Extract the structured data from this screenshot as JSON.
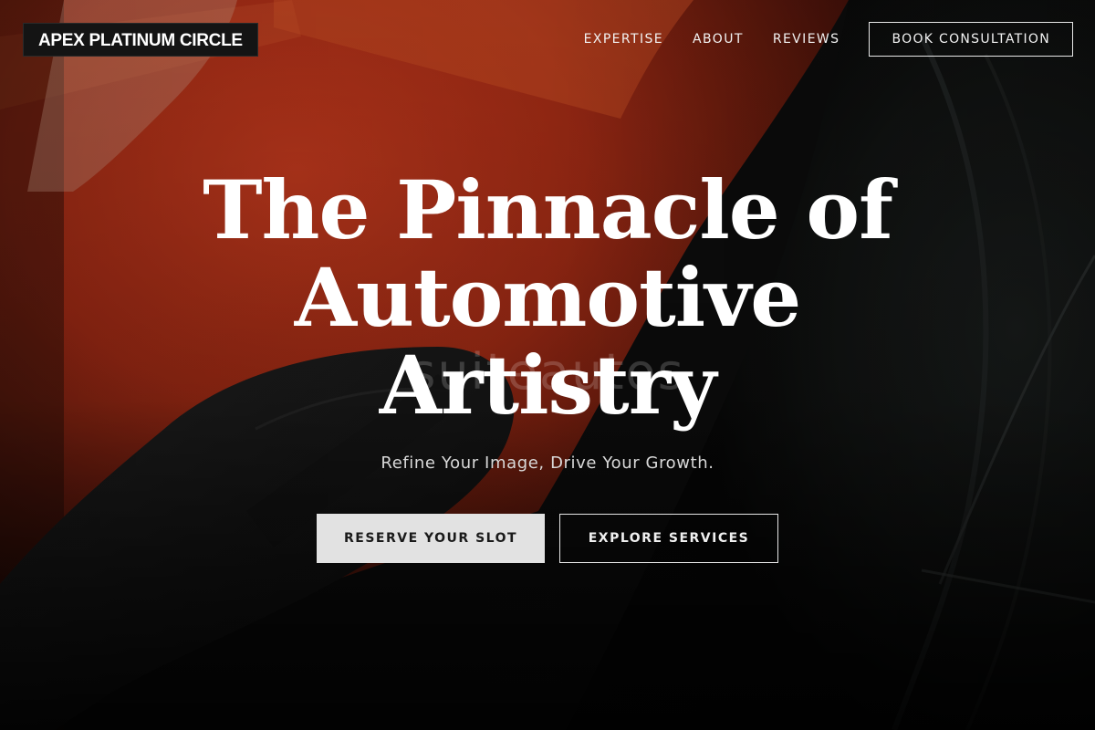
{
  "header": {
    "logo_text": "APEX PLATINUM CIRCLE",
    "nav": [
      {
        "label": "EXPERTISE"
      },
      {
        "label": "ABOUT"
      },
      {
        "label": "REVIEWS"
      }
    ],
    "cta_label": "BOOK CONSULTATION"
  },
  "hero": {
    "watermark": "suiteautos",
    "headline_lines": [
      "The Pinnacle of",
      "Automotive",
      "Artistry"
    ],
    "subtitle": "Refine Your Image, Drive Your Growth.",
    "primary_button": "RESERVE YOUR SLOT",
    "secondary_button": "EXPLORE SERVICES"
  },
  "colors": {
    "car_paint": "#b5321b",
    "background": "#0b0b0b",
    "primary_button_bg": "#e2e2e2",
    "text": "#ffffff"
  }
}
